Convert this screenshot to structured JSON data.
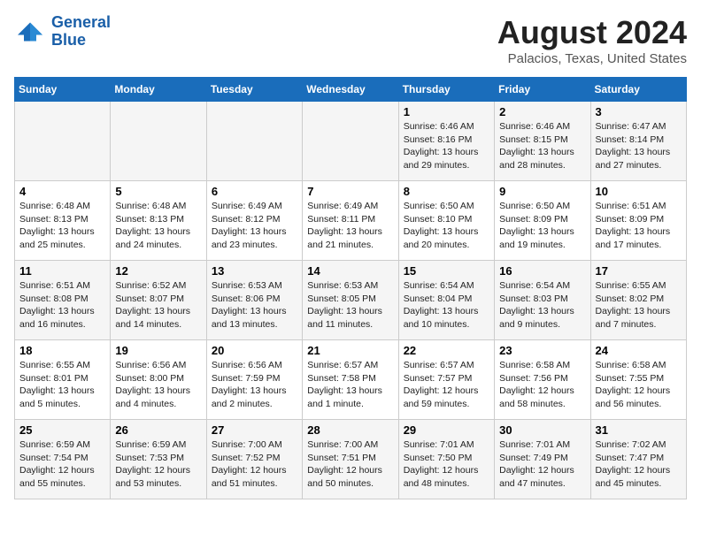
{
  "logo": {
    "line1": "General",
    "line2": "Blue"
  },
  "title": "August 2024",
  "subtitle": "Palacios, Texas, United States",
  "days_of_week": [
    "Sunday",
    "Monday",
    "Tuesday",
    "Wednesday",
    "Thursday",
    "Friday",
    "Saturday"
  ],
  "weeks": [
    [
      {
        "day": "",
        "info": ""
      },
      {
        "day": "",
        "info": ""
      },
      {
        "day": "",
        "info": ""
      },
      {
        "day": "",
        "info": ""
      },
      {
        "day": "1",
        "info": "Sunrise: 6:46 AM\nSunset: 8:16 PM\nDaylight: 13 hours\nand 29 minutes."
      },
      {
        "day": "2",
        "info": "Sunrise: 6:46 AM\nSunset: 8:15 PM\nDaylight: 13 hours\nand 28 minutes."
      },
      {
        "day": "3",
        "info": "Sunrise: 6:47 AM\nSunset: 8:14 PM\nDaylight: 13 hours\nand 27 minutes."
      }
    ],
    [
      {
        "day": "4",
        "info": "Sunrise: 6:48 AM\nSunset: 8:13 PM\nDaylight: 13 hours\nand 25 minutes."
      },
      {
        "day": "5",
        "info": "Sunrise: 6:48 AM\nSunset: 8:13 PM\nDaylight: 13 hours\nand 24 minutes."
      },
      {
        "day": "6",
        "info": "Sunrise: 6:49 AM\nSunset: 8:12 PM\nDaylight: 13 hours\nand 23 minutes."
      },
      {
        "day": "7",
        "info": "Sunrise: 6:49 AM\nSunset: 8:11 PM\nDaylight: 13 hours\nand 21 minutes."
      },
      {
        "day": "8",
        "info": "Sunrise: 6:50 AM\nSunset: 8:10 PM\nDaylight: 13 hours\nand 20 minutes."
      },
      {
        "day": "9",
        "info": "Sunrise: 6:50 AM\nSunset: 8:09 PM\nDaylight: 13 hours\nand 19 minutes."
      },
      {
        "day": "10",
        "info": "Sunrise: 6:51 AM\nSunset: 8:09 PM\nDaylight: 13 hours\nand 17 minutes."
      }
    ],
    [
      {
        "day": "11",
        "info": "Sunrise: 6:51 AM\nSunset: 8:08 PM\nDaylight: 13 hours\nand 16 minutes."
      },
      {
        "day": "12",
        "info": "Sunrise: 6:52 AM\nSunset: 8:07 PM\nDaylight: 13 hours\nand 14 minutes."
      },
      {
        "day": "13",
        "info": "Sunrise: 6:53 AM\nSunset: 8:06 PM\nDaylight: 13 hours\nand 13 minutes."
      },
      {
        "day": "14",
        "info": "Sunrise: 6:53 AM\nSunset: 8:05 PM\nDaylight: 13 hours\nand 11 minutes."
      },
      {
        "day": "15",
        "info": "Sunrise: 6:54 AM\nSunset: 8:04 PM\nDaylight: 13 hours\nand 10 minutes."
      },
      {
        "day": "16",
        "info": "Sunrise: 6:54 AM\nSunset: 8:03 PM\nDaylight: 13 hours\nand 9 minutes."
      },
      {
        "day": "17",
        "info": "Sunrise: 6:55 AM\nSunset: 8:02 PM\nDaylight: 13 hours\nand 7 minutes."
      }
    ],
    [
      {
        "day": "18",
        "info": "Sunrise: 6:55 AM\nSunset: 8:01 PM\nDaylight: 13 hours\nand 5 minutes."
      },
      {
        "day": "19",
        "info": "Sunrise: 6:56 AM\nSunset: 8:00 PM\nDaylight: 13 hours\nand 4 minutes."
      },
      {
        "day": "20",
        "info": "Sunrise: 6:56 AM\nSunset: 7:59 PM\nDaylight: 13 hours\nand 2 minutes."
      },
      {
        "day": "21",
        "info": "Sunrise: 6:57 AM\nSunset: 7:58 PM\nDaylight: 13 hours\nand 1 minute."
      },
      {
        "day": "22",
        "info": "Sunrise: 6:57 AM\nSunset: 7:57 PM\nDaylight: 12 hours\nand 59 minutes."
      },
      {
        "day": "23",
        "info": "Sunrise: 6:58 AM\nSunset: 7:56 PM\nDaylight: 12 hours\nand 58 minutes."
      },
      {
        "day": "24",
        "info": "Sunrise: 6:58 AM\nSunset: 7:55 PM\nDaylight: 12 hours\nand 56 minutes."
      }
    ],
    [
      {
        "day": "25",
        "info": "Sunrise: 6:59 AM\nSunset: 7:54 PM\nDaylight: 12 hours\nand 55 minutes."
      },
      {
        "day": "26",
        "info": "Sunrise: 6:59 AM\nSunset: 7:53 PM\nDaylight: 12 hours\nand 53 minutes."
      },
      {
        "day": "27",
        "info": "Sunrise: 7:00 AM\nSunset: 7:52 PM\nDaylight: 12 hours\nand 51 minutes."
      },
      {
        "day": "28",
        "info": "Sunrise: 7:00 AM\nSunset: 7:51 PM\nDaylight: 12 hours\nand 50 minutes."
      },
      {
        "day": "29",
        "info": "Sunrise: 7:01 AM\nSunset: 7:50 PM\nDaylight: 12 hours\nand 48 minutes."
      },
      {
        "day": "30",
        "info": "Sunrise: 7:01 AM\nSunset: 7:49 PM\nDaylight: 12 hours\nand 47 minutes."
      },
      {
        "day": "31",
        "info": "Sunrise: 7:02 AM\nSunset: 7:47 PM\nDaylight: 12 hours\nand 45 minutes."
      }
    ]
  ]
}
